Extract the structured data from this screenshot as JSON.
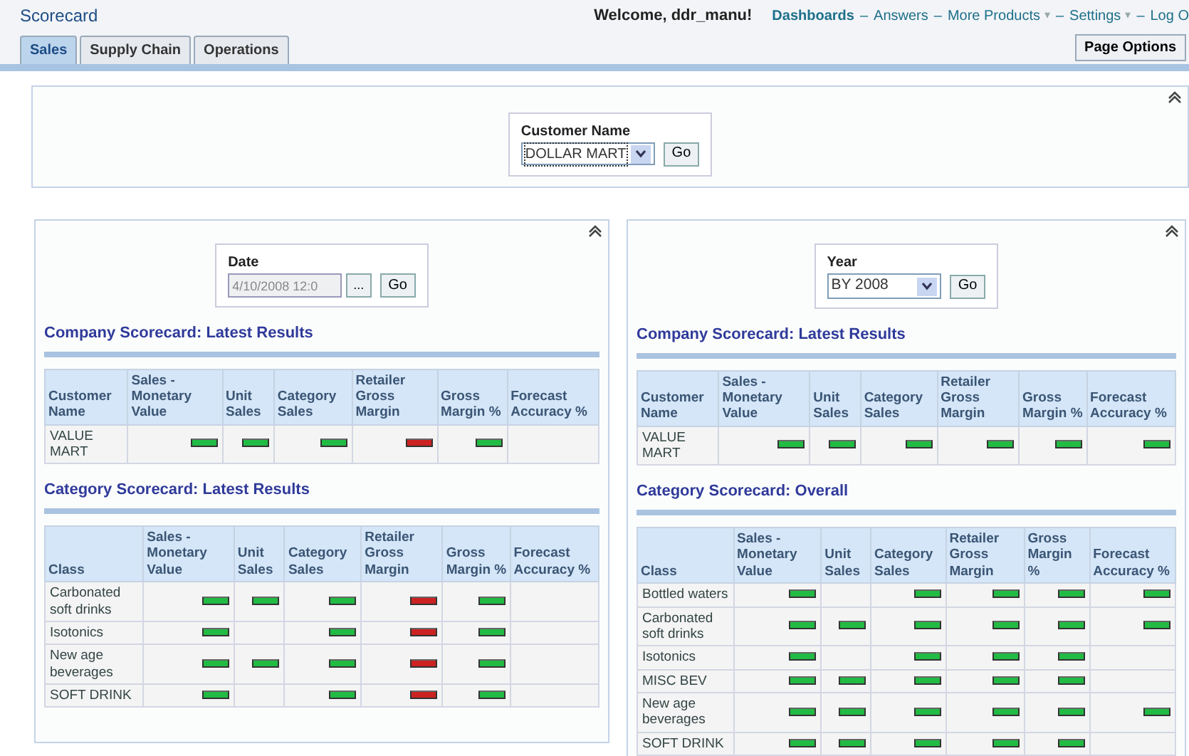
{
  "header": {
    "title": "Scorecard",
    "welcome": "Welcome, ddr_manu!",
    "links": [
      {
        "kind": "link",
        "text": "Dashboards",
        "bold": true
      },
      {
        "kind": "separator",
        "text": "–"
      },
      {
        "kind": "link",
        "text": "Answers",
        "bold": false
      },
      {
        "kind": "separator",
        "text": "–"
      },
      {
        "kind": "link",
        "text": "More Products",
        "bold": false
      },
      {
        "kind": "caret",
        "text": "▾"
      },
      {
        "kind": "separator",
        "text": "–"
      },
      {
        "kind": "link",
        "text": "Settings",
        "bold": false
      },
      {
        "kind": "caret",
        "text": "▾"
      },
      {
        "kind": "separator",
        "text": "–"
      },
      {
        "kind": "link",
        "text": "Log O",
        "bold": false
      }
    ]
  },
  "tabs": [
    {
      "label": "Sales",
      "selected": true
    },
    {
      "label": "Supply Chain",
      "selected": false
    },
    {
      "label": "Operations",
      "selected": false
    }
  ],
  "page_options": "Page Options",
  "customer_prompt": {
    "label": "Customer Name",
    "value": "DOLLAR MART",
    "button": "Go"
  },
  "panels": [
    {
      "prompt": {
        "kind": "date",
        "label": "Date",
        "value": "4/10/2008 12:0",
        "picker": "...",
        "button": "Go"
      },
      "sections": [
        {
          "title": "Company Scorecard: Latest Results",
          "columns": [
            "Customer Name",
            "Sales - Monetary Value",
            "Unit Sales",
            "Category Sales",
            "Retailer Gross Margin",
            "Gross Margin %",
            "Forecast Accuracy %"
          ],
          "rows": [
            {
              "label": "VALUE MART",
              "cells": [
                {
                  "color": "#22bb44"
                },
                {
                  "color": "#22bb44"
                },
                {
                  "color": "#22bb44"
                },
                {
                  "color": "#cc2222"
                },
                {
                  "color": "#22bb44"
                },
                null
              ]
            }
          ]
        },
        {
          "title": "Category Scorecard: Latest Results",
          "columns": [
            "Class",
            "Sales - Monetary Value",
            "Unit Sales",
            "Category Sales",
            "Retailer Gross Margin",
            "Gross Margin %",
            "Forecast Accuracy %"
          ],
          "rows": [
            {
              "label": "Carbonated soft drinks",
              "cells": [
                {
                  "color": "#22bb44"
                },
                {
                  "color": "#22bb44"
                },
                {
                  "color": "#22bb44"
                },
                {
                  "color": "#cc2222"
                },
                {
                  "color": "#22bb44"
                },
                null
              ]
            },
            {
              "label": "Isotonics",
              "cells": [
                {
                  "color": "#22bb44"
                },
                null,
                {
                  "color": "#22bb44"
                },
                {
                  "color": "#cc2222"
                },
                {
                  "color": "#22bb44"
                },
                null
              ]
            },
            {
              "label": "New age beverages",
              "cells": [
                {
                  "color": "#22bb44"
                },
                {
                  "color": "#22bb44"
                },
                {
                  "color": "#22bb44"
                },
                {
                  "color": "#cc2222"
                },
                {
                  "color": "#22bb44"
                },
                null
              ]
            },
            {
              "label": "SOFT DRINK",
              "cells": [
                {
                  "color": "#22bb44"
                },
                null,
                {
                  "color": "#22bb44"
                },
                {
                  "color": "#cc2222"
                },
                {
                  "color": "#22bb44"
                },
                null
              ]
            }
          ]
        }
      ]
    },
    {
      "prompt": {
        "kind": "select",
        "label": "Year",
        "value": "BY 2008",
        "button": "Go"
      },
      "sections": [
        {
          "title": "Company Scorecard: Latest Results",
          "columns": [
            "Customer Name",
            "Sales - Monetary Value",
            "Unit Sales",
            "Category Sales",
            "Retailer Gross Margin",
            "Gross Margin %",
            "Forecast Accuracy %"
          ],
          "rows": [
            {
              "label": "VALUE MART",
              "cells": [
                {
                  "color": "#22bb44"
                },
                {
                  "color": "#22bb44"
                },
                {
                  "color": "#22bb44"
                },
                {
                  "color": "#22bb44"
                },
                {
                  "color": "#22bb44"
                },
                {
                  "color": "#22bb44"
                }
              ]
            }
          ]
        },
        {
          "title": "Category Scorecard: Overall",
          "columns": [
            "Class",
            "Sales - Monetary Value",
            "Unit Sales",
            "Category Sales",
            "Retailer Gross Margin",
            "Gross Margin %",
            "Forecast Accuracy %"
          ],
          "rows": [
            {
              "label": "Bottled waters",
              "cells": [
                {
                  "color": "#22bb44"
                },
                null,
                {
                  "color": "#22bb44"
                },
                {
                  "color": "#22bb44"
                },
                {
                  "color": "#22bb44"
                },
                {
                  "color": "#22bb44"
                }
              ]
            },
            {
              "label": "Carbonated soft drinks",
              "cells": [
                {
                  "color": "#22bb44"
                },
                {
                  "color": "#22bb44"
                },
                {
                  "color": "#22bb44"
                },
                {
                  "color": "#22bb44"
                },
                {
                  "color": "#22bb44"
                },
                {
                  "color": "#22bb44"
                }
              ]
            },
            {
              "label": "Isotonics",
              "cells": [
                {
                  "color": "#22bb44"
                },
                null,
                {
                  "color": "#22bb44"
                },
                {
                  "color": "#22bb44"
                },
                {
                  "color": "#22bb44"
                },
                null
              ]
            },
            {
              "label": "MISC BEV",
              "cells": [
                {
                  "color": "#22bb44"
                },
                {
                  "color": "#22bb44"
                },
                {
                  "color": "#22bb44"
                },
                {
                  "color": "#22bb44"
                },
                {
                  "color": "#22bb44"
                },
                null
              ]
            },
            {
              "label": "New age beverages",
              "cells": [
                {
                  "color": "#22bb44"
                },
                {
                  "color": "#22bb44"
                },
                {
                  "color": "#22bb44"
                },
                {
                  "color": "#22bb44"
                },
                {
                  "color": "#22bb44"
                },
                {
                  "color": "#22bb44"
                }
              ]
            },
            {
              "label": "SOFT DRINK",
              "cells": [
                {
                  "color": "#22bb44"
                },
                {
                  "color": "#22bb44"
                },
                {
                  "color": "#22bb44"
                },
                {
                  "color": "#22bb44"
                },
                {
                  "color": "#22bb44"
                },
                null
              ]
            }
          ]
        }
      ]
    }
  ]
}
